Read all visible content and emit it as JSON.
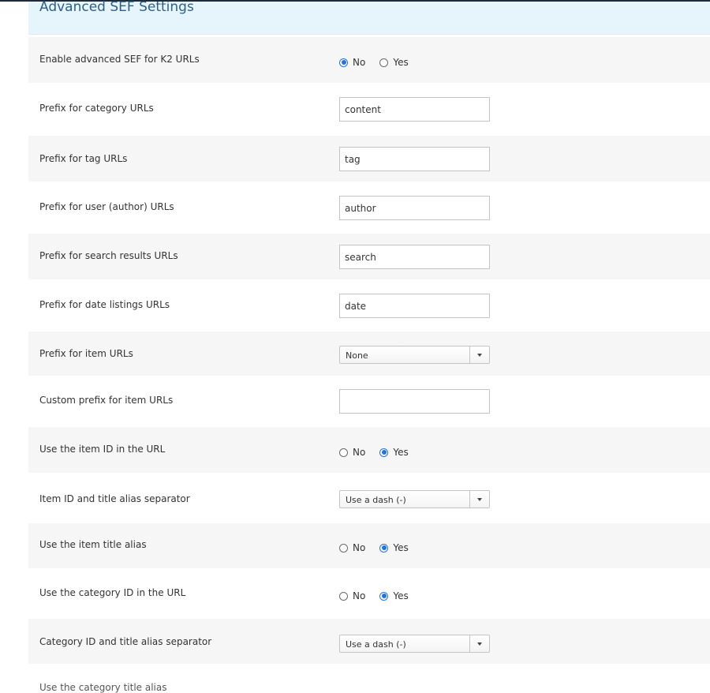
{
  "section": {
    "title": "Advanced SEF Settings"
  },
  "settings": [
    {
      "type": "radio",
      "label": "Enable advanced SEF for K2 URLs",
      "options": [
        "No",
        "Yes"
      ],
      "selected": "No"
    },
    {
      "type": "text",
      "label": "Prefix for category URLs",
      "value": "content"
    },
    {
      "type": "text",
      "label": "Prefix for tag URLs",
      "value": "tag"
    },
    {
      "type": "text",
      "label": "Prefix for user (author) URLs",
      "value": "author"
    },
    {
      "type": "text",
      "label": "Prefix for search results URLs",
      "value": "search"
    },
    {
      "type": "text",
      "label": "Prefix for date listings URLs",
      "value": "date"
    },
    {
      "type": "select",
      "label": "Prefix for item URLs",
      "value": "None"
    },
    {
      "type": "text",
      "label": "Custom prefix for item URLs",
      "value": ""
    },
    {
      "type": "radio",
      "label": "Use the item ID in the URL",
      "options": [
        "No",
        "Yes"
      ],
      "selected": "Yes"
    },
    {
      "type": "select",
      "label": "Item ID and title alias separator",
      "value": "Use a dash (-)"
    },
    {
      "type": "radio",
      "label": "Use the item title alias",
      "options": [
        "No",
        "Yes"
      ],
      "selected": "Yes"
    },
    {
      "type": "radio",
      "label": "Use the category ID in the URL",
      "options": [
        "No",
        "Yes"
      ],
      "selected": "Yes"
    },
    {
      "type": "select",
      "label": "Category ID and title alias separator",
      "value": "Use a dash (-)"
    }
  ],
  "cutoff_label": "Use the category title alias",
  "colors": {
    "header_bg": "#e6f5fb",
    "header_text": "#2f5f86",
    "row_shade": "#f6f6f6",
    "radio_accent": "#2473d6"
  }
}
